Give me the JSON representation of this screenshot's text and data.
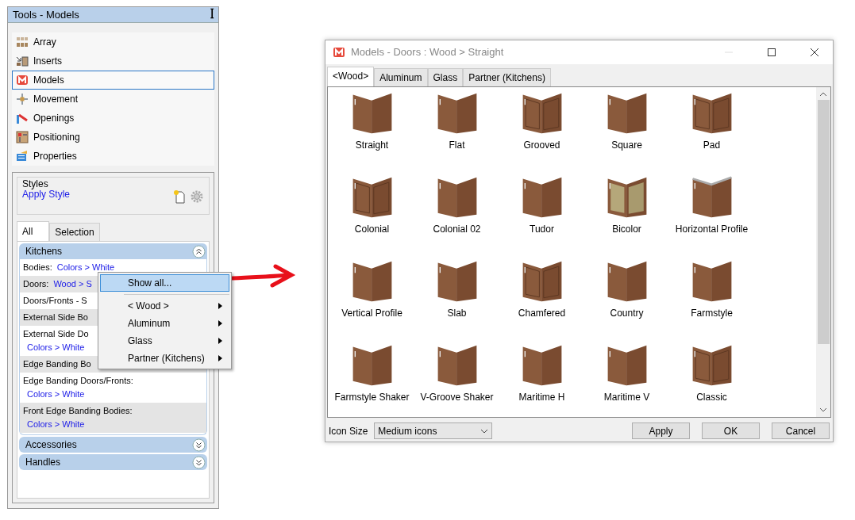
{
  "panel": {
    "title": "Tools - Models",
    "pin": "ꟾ",
    "items": [
      {
        "label": "Array",
        "selected": false
      },
      {
        "label": "Inserts",
        "selected": false
      },
      {
        "label": "Models",
        "selected": true
      },
      {
        "label": "Movement",
        "selected": false
      },
      {
        "label": "Openings",
        "selected": false
      },
      {
        "label": "Positioning",
        "selected": false
      },
      {
        "label": "Properties",
        "selected": false
      }
    ],
    "styles": {
      "legend": "Styles",
      "link": "Apply Style"
    },
    "tabs": [
      {
        "label": "All",
        "selected": true
      },
      {
        "label": "Selection",
        "selected": false
      }
    ],
    "sections": [
      {
        "title": "Kitchens",
        "expanded": true,
        "rows": [
          {
            "label": "Bodies:",
            "value": "Colors > White",
            "wrapped": false
          },
          {
            "label": "Doors:",
            "value": "Wood > S",
            "wrapped": false
          },
          {
            "label": "Doors/Fronts - S"
          },
          {
            "label": "External Side Bo"
          },
          {
            "label": "External Side Do",
            "value": "Colors > White",
            "wrapped": true
          },
          {
            "label": "Edge Banding Bo"
          },
          {
            "label": "Edge Banding Doors/Fronts:",
            "value": "Colors > White",
            "wrapped": true
          },
          {
            "label": "Front Edge Banding Bodies:",
            "value": "Colors > White",
            "wrapped": true
          }
        ]
      },
      {
        "title": "Accessories",
        "expanded": false
      },
      {
        "title": "Handles",
        "expanded": false
      }
    ]
  },
  "context_menu": [
    {
      "kind": "command",
      "label": "Show all...",
      "selected": true
    },
    {
      "kind": "separator"
    },
    {
      "kind": "submenu",
      "label": "< Wood >",
      "selected": false
    },
    {
      "kind": "submenu",
      "label": "Aluminum",
      "selected": false
    },
    {
      "kind": "submenu",
      "label": "Glass",
      "selected": false
    },
    {
      "kind": "submenu",
      "label": "Partner (Kitchens)",
      "selected": false
    }
  ],
  "dialog": {
    "title": "Models - Doors : Wood > Straight",
    "tabs": [
      {
        "label": "<Wood>",
        "selected": true
      },
      {
        "label": "Aluminum",
        "selected": false
      },
      {
        "label": "Glass",
        "selected": false
      },
      {
        "label": "Partner (Kitchens)",
        "selected": false
      }
    ],
    "models": [
      {
        "label": "Straight",
        "kind": "plain"
      },
      {
        "label": "Flat",
        "kind": "plain"
      },
      {
        "label": "Grooved",
        "kind": "panel"
      },
      {
        "label": "Square",
        "kind": "plain"
      },
      {
        "label": "Pad",
        "kind": "panel"
      },
      {
        "label": "Colonial",
        "kind": "panel"
      },
      {
        "label": "Colonial 02",
        "kind": "plain"
      },
      {
        "label": "Tudor",
        "kind": "plain"
      },
      {
        "label": "Bicolor",
        "kind": "bicolor"
      },
      {
        "label": "Horizontal Profile",
        "kind": "profile"
      },
      {
        "label": "Vertical Profile",
        "kind": "plain"
      },
      {
        "label": "Slab",
        "kind": "plain"
      },
      {
        "label": "Chamfered",
        "kind": "panel"
      },
      {
        "label": "Country",
        "kind": "plain"
      },
      {
        "label": "Farmstyle",
        "kind": "plain"
      },
      {
        "label": "Farmstyle Shaker",
        "kind": "plain"
      },
      {
        "label": "V-Groove Shaker",
        "kind": "plain"
      },
      {
        "label": "Maritime H",
        "kind": "plain"
      },
      {
        "label": "Maritime V",
        "kind": "plain"
      },
      {
        "label": "Classic",
        "kind": "panel"
      }
    ],
    "icon_size_label": "Icon Size",
    "icon_size": "Medium icons",
    "buttons": [
      "Apply",
      "OK",
      "Cancel"
    ]
  }
}
